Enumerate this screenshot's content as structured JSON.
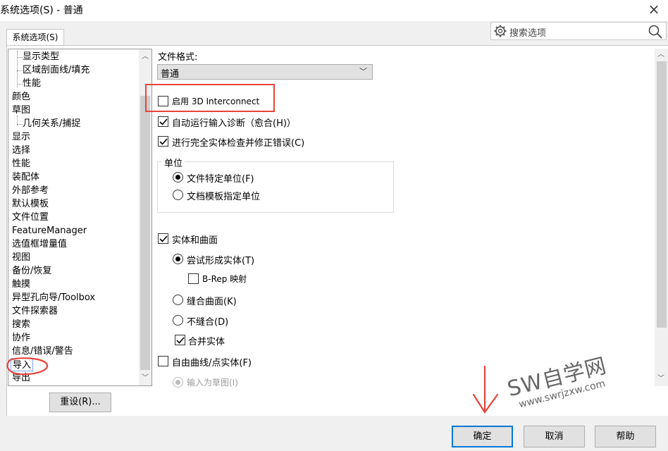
{
  "window": {
    "title": "系统选项(S) - 普通",
    "close": "×"
  },
  "tab": {
    "label": "系统选项(S)"
  },
  "search": {
    "placeholder": "搜索选项"
  },
  "tree": {
    "items": [
      {
        "label": "显示类型",
        "child": true
      },
      {
        "label": "区域剖面线/填充",
        "child": true
      },
      {
        "label": "性能",
        "child": true
      },
      {
        "label": "颜色",
        "child": false
      },
      {
        "label": "草图",
        "child": false
      },
      {
        "label": "几何关系/捕捉",
        "child": true
      },
      {
        "label": "显示",
        "child": false
      },
      {
        "label": "选择",
        "child": false
      },
      {
        "label": "性能",
        "child": false
      },
      {
        "label": "装配体",
        "child": false
      },
      {
        "label": "外部参考",
        "child": false
      },
      {
        "label": "默认模板",
        "child": false
      },
      {
        "label": "文件位置",
        "child": false
      },
      {
        "label": "FeatureManager",
        "child": false
      },
      {
        "label": "选值框增量值",
        "child": false
      },
      {
        "label": "视图",
        "child": false
      },
      {
        "label": "备份/恢复",
        "child": false
      },
      {
        "label": "触摸",
        "child": false
      },
      {
        "label": "异型孔向导/Toolbox",
        "child": false
      },
      {
        "label": "文件探索器",
        "child": false
      },
      {
        "label": "搜索",
        "child": false
      },
      {
        "label": "协作",
        "child": false
      },
      {
        "label": "信息/错误/警告",
        "child": false
      },
      {
        "label": "导入",
        "child": false,
        "selected": true
      },
      {
        "label": "导出",
        "child": false
      }
    ]
  },
  "reset_button": "重设(R)...",
  "options": {
    "file_format_label": "文件格式:",
    "file_format_value": "普通",
    "enable_3d_interconnect": "启用 3D Interconnect",
    "auto_diagnose": "自动运行输入诊断（愈合(H)）",
    "full_check": "进行完全实体检查并修正错误(C)",
    "unit_group_title": "单位",
    "unit_file_specific": "文件特定单位(F)",
    "unit_template": "文档模板指定单位",
    "solid_and_surface": "实体和曲面",
    "try_form_solid": "尝试形成实体(T)",
    "brep_mapping": "B-Rep 映射",
    "knit_surfaces": "缝合曲面(K)",
    "no_knit": "不缝合(D)",
    "merge_entities": "合并实体",
    "free_curves": "自由曲线/点实体(F)",
    "import_as_sketch": "输入为草图(I)"
  },
  "state": {
    "enable_3d_interconnect": false,
    "auto_diagnose": true,
    "full_check": true,
    "unit": "file_specific",
    "solid_and_surface": true,
    "form_mode": "try_form_solid",
    "brep_mapping": false,
    "merge_entities": true,
    "free_curves": false
  },
  "buttons": {
    "ok": "确定",
    "cancel": "取消",
    "help": "帮助"
  },
  "watermark": {
    "brand": "SW自学网",
    "url": "www.swrjzxw.com"
  },
  "colors": {
    "annotation_red": "#e8443a",
    "focus_blue": "#0078d7",
    "selection_border": "#7ea5ff"
  }
}
